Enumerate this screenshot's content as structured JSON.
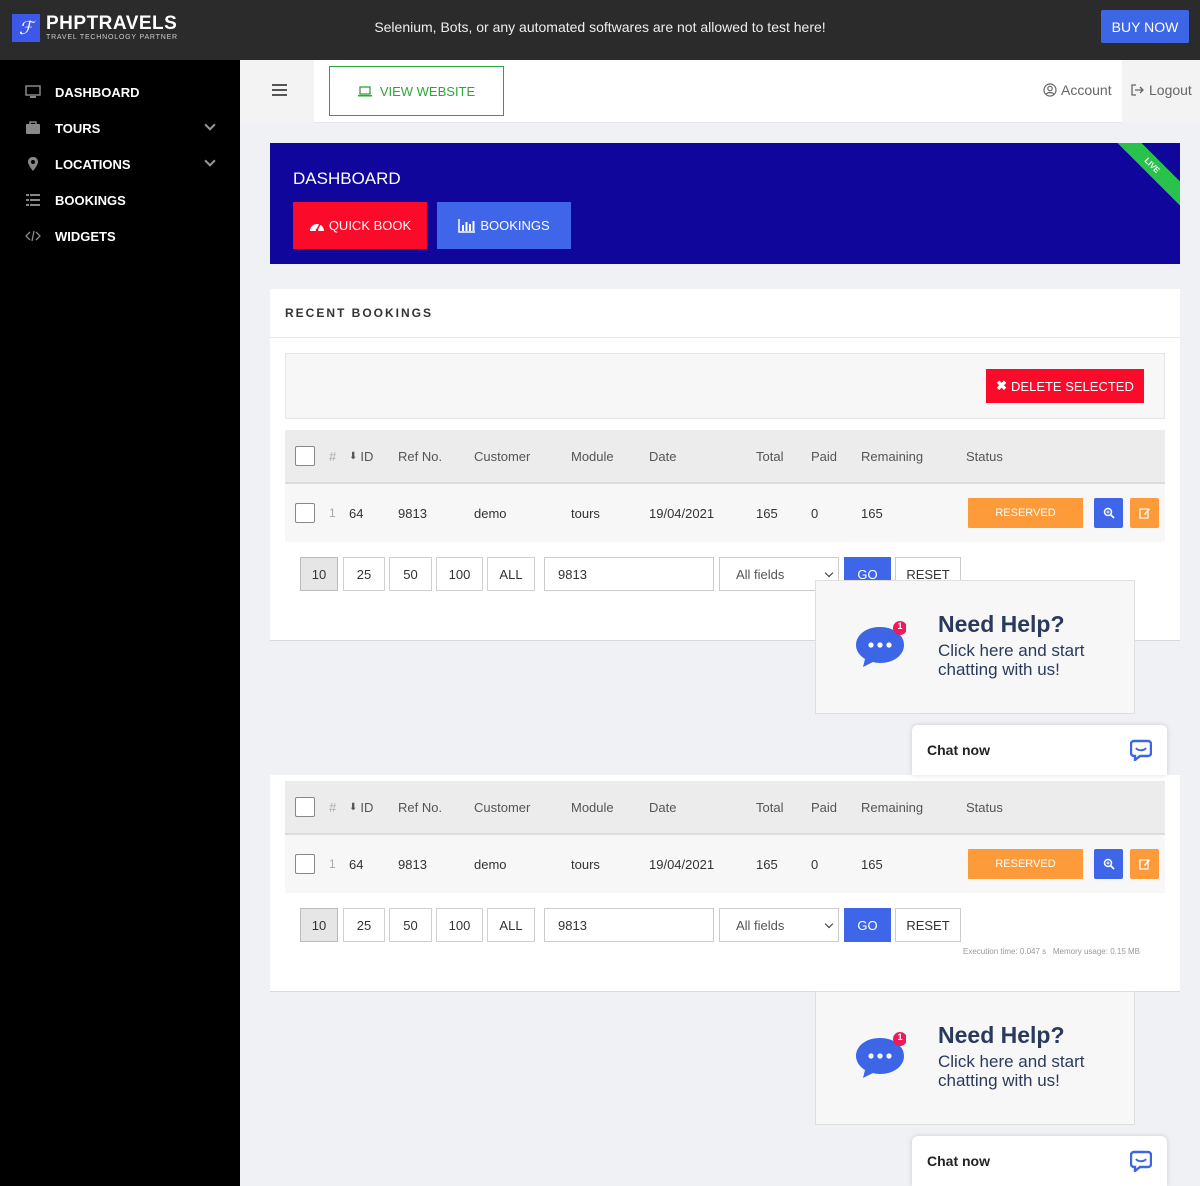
{
  "topbar": {
    "brand": "PHPTRAVELS",
    "brand_sub": "TRAVEL TECHNOLOGY PARTNER",
    "notice": "Selenium, Bots, or any automated softwares are not allowed to test here!",
    "buy_now": "BUY NOW"
  },
  "sidebar": {
    "items": [
      {
        "label": "DASHBOARD",
        "icon": "monitor-icon"
      },
      {
        "label": "TOURS",
        "icon": "briefcase-icon",
        "expandable": true
      },
      {
        "label": "LOCATIONS",
        "icon": "map-pin-icon",
        "expandable": true
      },
      {
        "label": "BOOKINGS",
        "icon": "list-icon"
      },
      {
        "label": "WIDGETS",
        "icon": "code-icon"
      }
    ]
  },
  "header": {
    "view_website": "VIEW WEBSITE",
    "account": "Account",
    "logout": "Logout"
  },
  "banner": {
    "title": "DASHBOARD",
    "quick_book": "QUICK BOOK",
    "bookings": "BOOKINGS",
    "ribbon": "LIVE",
    "colors": {
      "background": "#11069b",
      "quick_book": "#fb0a2a",
      "bookings": "#3f66e8",
      "ribbon": "#29c24a"
    }
  },
  "recent": {
    "title": "RECENT BOOKINGS",
    "delete_selected": "DELETE SELECTED"
  },
  "table": {
    "columns": {
      "hash": "#",
      "id": "ID",
      "ref": "Ref No.",
      "customer": "Customer",
      "module": "Module",
      "date": "Date",
      "total": "Total",
      "paid": "Paid",
      "remaining": "Remaining",
      "status": "Status"
    },
    "rows": [
      {
        "index": "1",
        "id": "64",
        "ref": "9813",
        "customer": "demo",
        "module": "tours",
        "date": "19/04/2021",
        "total": "165",
        "paid": "0",
        "remaining": "165",
        "status": "RESERVED"
      }
    ]
  },
  "pager": {
    "sizes": [
      "10",
      "25",
      "50",
      "100",
      "ALL"
    ],
    "active_size": "10",
    "search_value": "9813",
    "field_select": "All fields",
    "go": "GO",
    "reset": "RESET",
    "exec_time": "Execution time: 0.047 s",
    "memory": "Memory usage: 0.15 MB"
  },
  "help": {
    "title": "Need Help?",
    "text": "Click here and start chatting with us!",
    "badge": "1"
  },
  "chat": {
    "label": "Chat now"
  }
}
